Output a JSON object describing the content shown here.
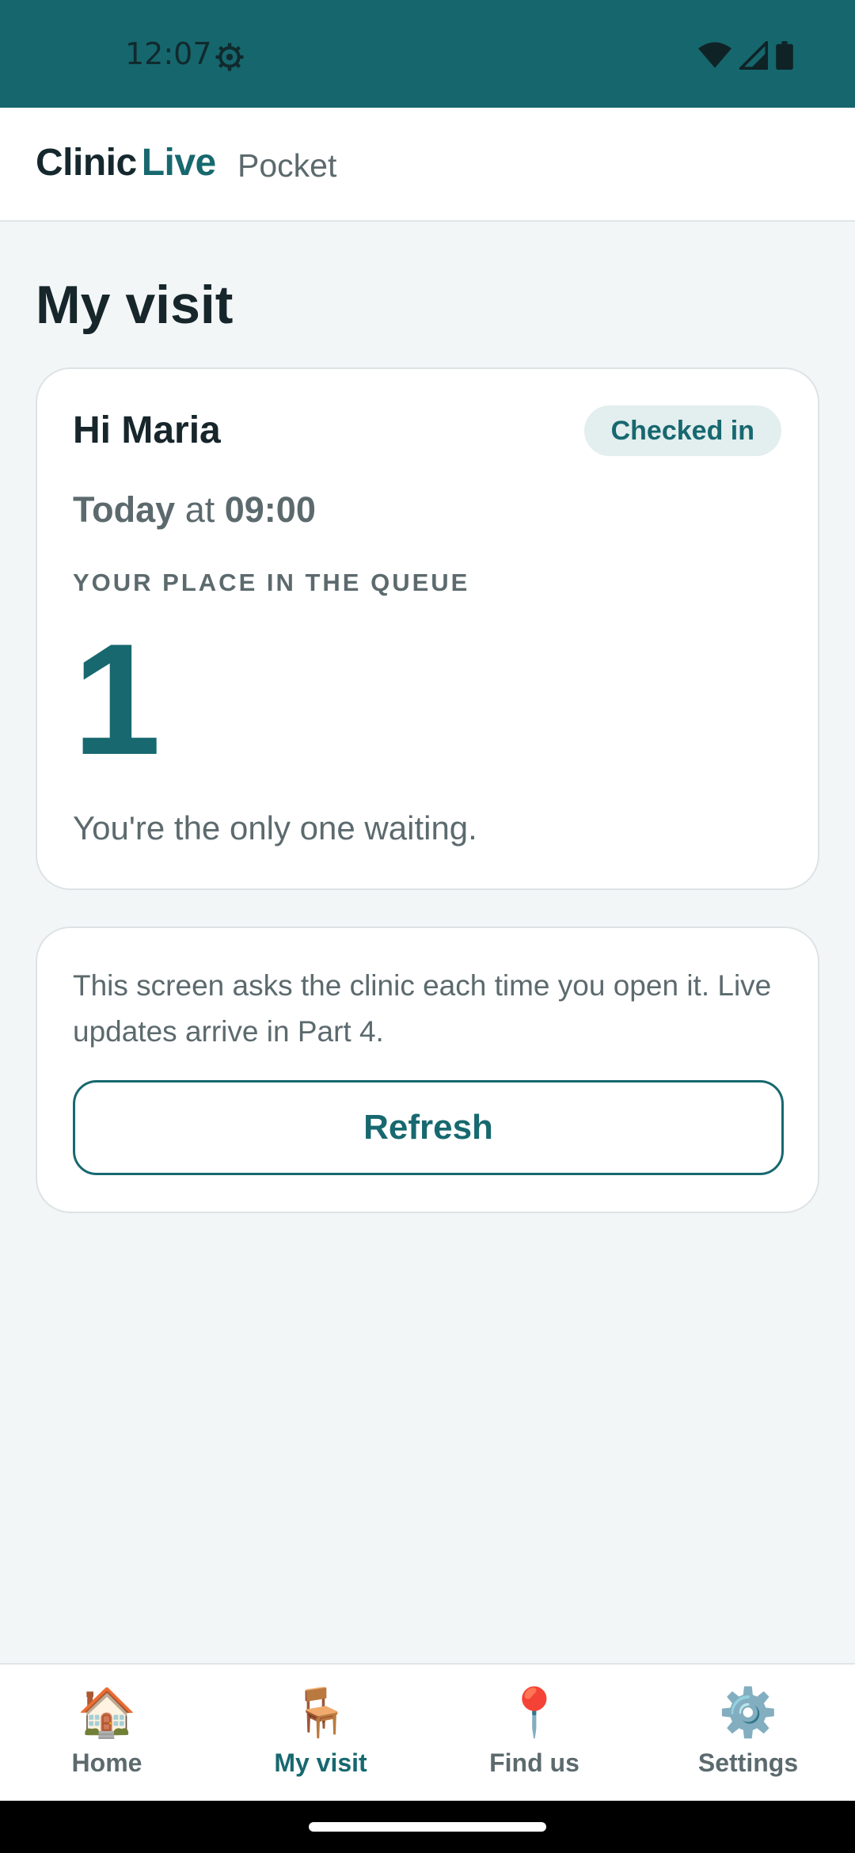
{
  "status_bar": {
    "time": "12:07",
    "icons": [
      "gear-icon",
      "wifi-icon",
      "signal-icon",
      "battery-icon"
    ]
  },
  "header": {
    "brand_clinic": "Clinic",
    "brand_live": "Live",
    "subtitle": "Pocket"
  },
  "page": {
    "title": "My visit"
  },
  "visit_card": {
    "greeting": "Hi Maria",
    "status_badge": "Checked in",
    "day": "Today",
    "at_word": "at",
    "time": "09:00",
    "queue_label": "YOUR PLACE IN THE QUEUE",
    "queue_position": "1",
    "queue_note": "You're the only one waiting."
  },
  "info_card": {
    "text": "This screen asks the clinic each time you open it. Live updates arrive in Part 4.",
    "refresh_label": "Refresh"
  },
  "bottom_nav": {
    "items": [
      {
        "label": "Home",
        "icon": "house-icon",
        "glyph": "🏠",
        "active": false
      },
      {
        "label": "My visit",
        "icon": "chair-icon",
        "glyph": "🪑",
        "active": true
      },
      {
        "label": "Find us",
        "icon": "pin-icon",
        "glyph": "📍",
        "active": false
      },
      {
        "label": "Settings",
        "icon": "gear-icon",
        "glyph": "⚙️",
        "active": false
      }
    ]
  },
  "colors": {
    "brand_teal": "#17686f",
    "status_bar": "#16666d",
    "background": "#f3f6f7",
    "text_dark": "#16262b",
    "text_muted": "#5c6a6e",
    "badge_bg": "#e3eeee"
  }
}
